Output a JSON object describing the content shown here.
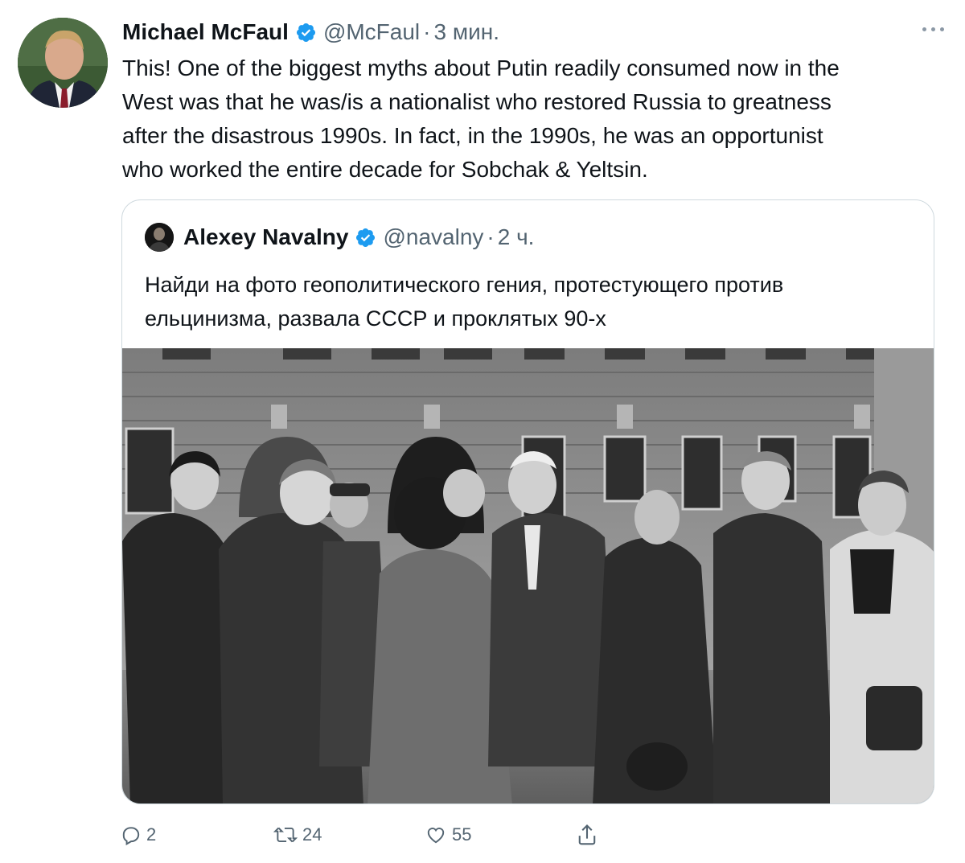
{
  "tweet": {
    "author_name": "Michael McFaul",
    "handle": "@McFaul",
    "separator": "·",
    "time": "3 мин.",
    "text_lines": [
      "This!  One of the biggest myths about Putin readily consumed now in the",
      "West was that he was/is a nationalist who restored Russia to greatness",
      "after the disastrous 1990s. In fact, in the 1990s, he was an opportunist",
      "who worked the entire decade for Sobchak & Yeltsin."
    ]
  },
  "quoted": {
    "author_name": "Alexey Navalny",
    "handle": "@navalny",
    "separator": "·",
    "time": "2 ч.",
    "text_lines": [
      "Найди на фото геополитического гения, протестующего против",
      "ельцинизма, развала СССР и проклятых 90-х"
    ]
  },
  "actions": {
    "reply_count": "2",
    "retweet_count": "24",
    "like_count": "55"
  },
  "colors": {
    "verified": "#1d9bf0",
    "secondary_text": "#536471",
    "border": "#cfd9de"
  }
}
